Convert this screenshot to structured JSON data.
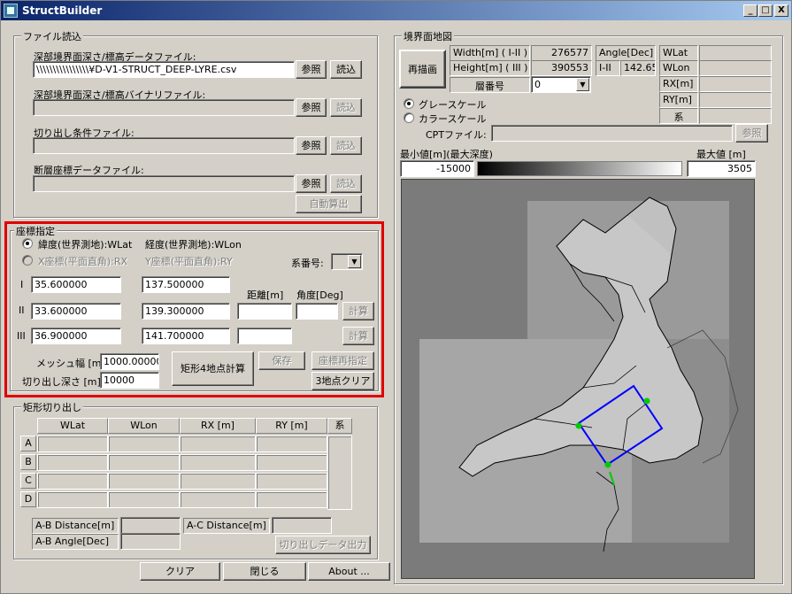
{
  "window": {
    "title": "StructBuilder",
    "min": "_",
    "max": "□",
    "close": "X"
  },
  "file_group": {
    "title": "ファイル読込",
    "deep_csv_label": "深部境界面深さ/標高データファイル:",
    "deep_csv_value": "\\\\\\\\\\\\\\\\\\\\\\\\\\\\\\\\¥D-V1-STRUCT_DEEP-LYRE.csv",
    "deep_bin_label": "深部境界面深さ/標高バイナリファイル:",
    "cut_cond_label": "切り出し条件ファイル:",
    "fault_label": "断層座標データファイル:",
    "browse": "参照",
    "load": "読込",
    "auto_calc": "自動算出"
  },
  "coord_group": {
    "title": "座標指定",
    "radio_latlon": "緯度(世界測地):WLat",
    "lon_label": "経度(世界測地):WLon",
    "radio_xy": "X座標(平面直角):RX",
    "y_label": "Y座標(平面直角):RY",
    "system_label": "系番号:",
    "row1_label": "I",
    "row2_label": "II",
    "row3_label": "III",
    "row1_lat": "35.600000",
    "row1_lon": "137.500000",
    "row2_lat": "33.600000",
    "row2_lon": "139.300000",
    "row3_lat": "36.900000",
    "row3_lon": "141.700000",
    "distance_label": "距離[m]",
    "angle_label": "角度[Deg]",
    "calc": "計算",
    "mesh_label": "メッシュ幅 [m]",
    "mesh_value": "1000.000000",
    "depth_label": "切り出し深さ [m]",
    "depth_value": "10000",
    "rect_calc": "矩形4地点計算",
    "save": "保存",
    "recoord": "座標再指定",
    "clear3": "3地点クリア"
  },
  "rect_group": {
    "title": "矩形切り出し",
    "headers": [
      "WLat",
      "WLon",
      "RX [m]",
      "RY [m]",
      "系"
    ],
    "rows": [
      "A",
      "B",
      "C",
      "D"
    ],
    "ab_dist": "A-B Distance[m]",
    "ac_dist": "A-C Distance[m]",
    "ab_angle": "A-B Angle[Dec]",
    "export": "切り出しデータ出力"
  },
  "bottom": {
    "clear": "クリア",
    "close": "閉じる",
    "about": "About ..."
  },
  "map_group": {
    "title": "境界面地図",
    "redraw": "再描画",
    "width_label": "Width[m] ( I-II )",
    "width_value": "276577",
    "height_label": "Height[m] ( III )",
    "height_value": "390553",
    "angle_label": "Angle[Dec]",
    "angle_sub": "I-II",
    "angle_value": "142.65",
    "layer_label": "層番号",
    "layer_value": "0",
    "wlat": "WLat",
    "wlon": "WLon",
    "rx": "RX[m]",
    "ry": "RY[m]",
    "kei": "系",
    "gray": "グレースケール",
    "color": "カラースケール",
    "cpt_label": "CPTファイル:",
    "cpt_browse": "参照",
    "min_label": "最小値[m](最大深度)",
    "max_label": "最大値 [m]",
    "min_value": "-15000",
    "max_value": "3505"
  },
  "colors": {
    "highlight": "#e00000",
    "rect": "#0000ff",
    "point": "#00cc00"
  }
}
